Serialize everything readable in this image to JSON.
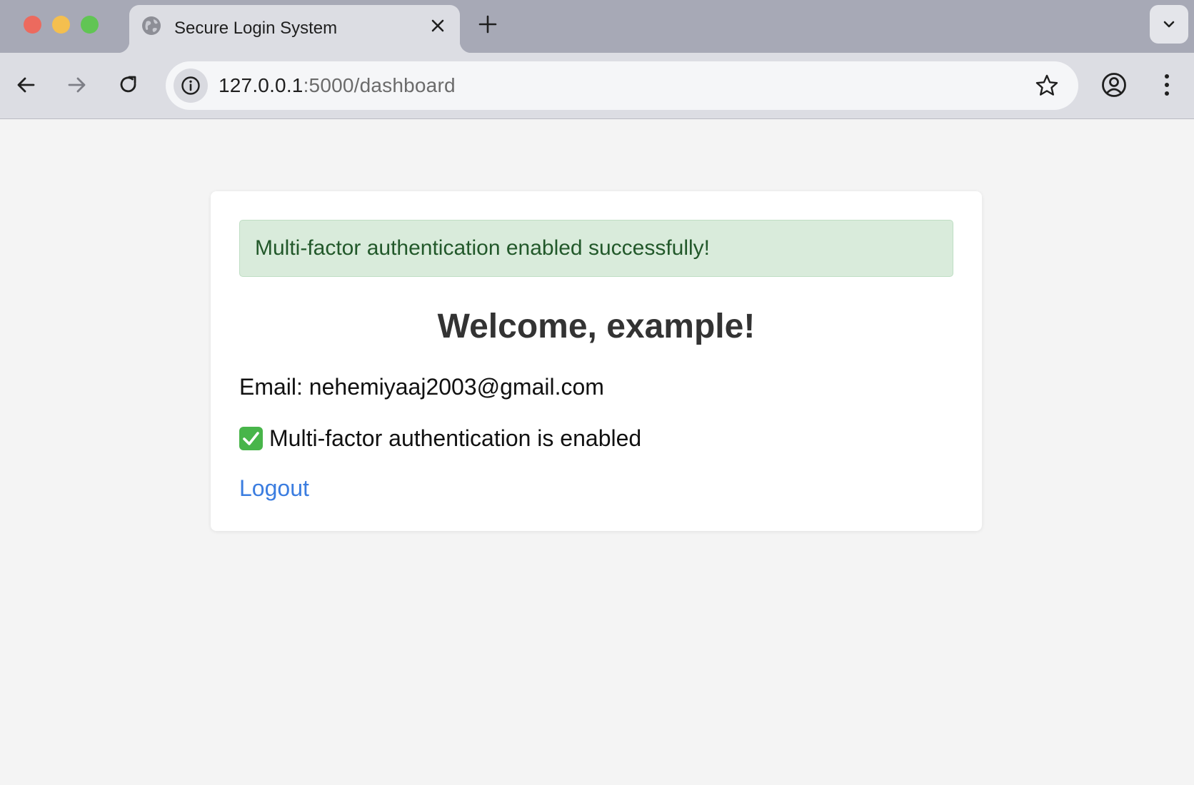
{
  "browser": {
    "tab_title": "Secure Login System",
    "url_host": "127.0.0.1",
    "url_path": ":5000/dashboard",
    "icons": [
      "globe-icon",
      "close-icon",
      "plus-icon",
      "chevron-down-icon",
      "back-arrow-icon",
      "forward-arrow-icon",
      "reload-icon",
      "info-icon",
      "star-icon",
      "profile-icon",
      "kebab-menu-icon"
    ]
  },
  "alert": {
    "message": "Multi-factor authentication enabled successfully!",
    "color": "#22582a",
    "background": "#d9ebdb"
  },
  "dashboard": {
    "welcome": "Welcome, example!",
    "email_line": "Email: nehemiyaaj2003@gmail.com",
    "mfa_status": "Multi-factor authentication is enabled",
    "mfa_icon": "check-mark-icon",
    "logout_label": "Logout",
    "link_color": "#3b7de0"
  }
}
